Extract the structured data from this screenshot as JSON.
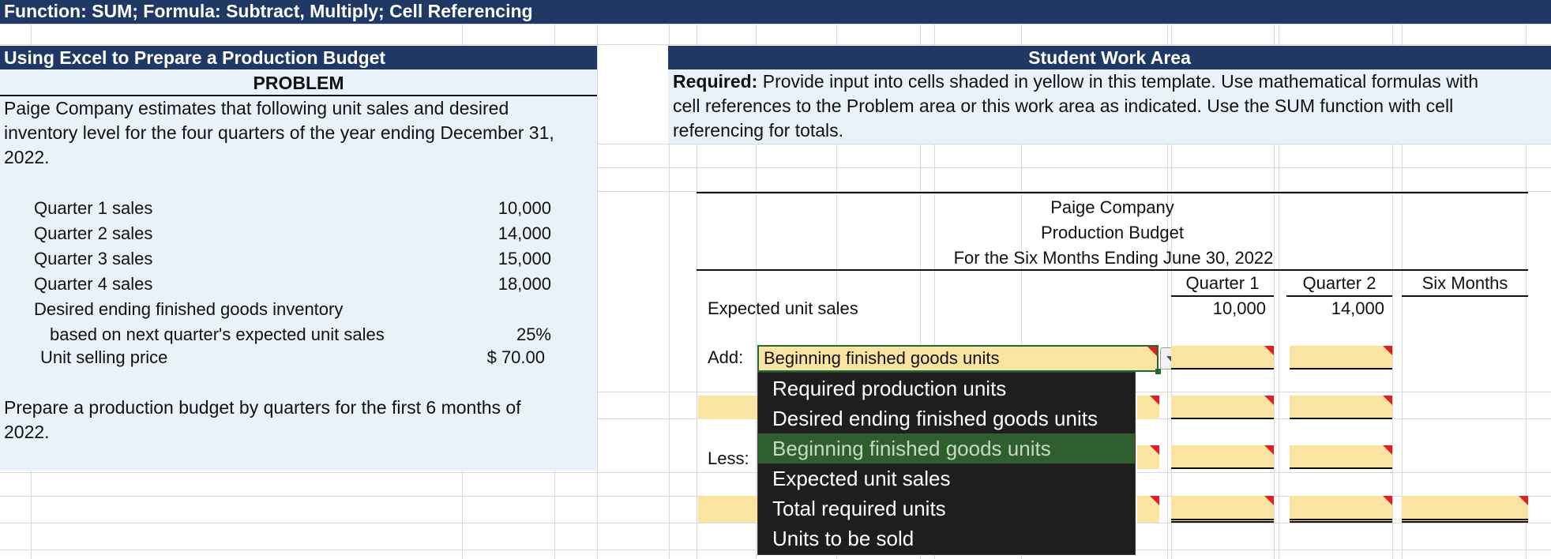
{
  "top_banner": "Function: SUM; Formula: Subtract, Multiply; Cell Referencing",
  "problem": {
    "header": "Using Excel to Prepare a Production Budget",
    "subheader": "PROBLEM",
    "desc_line1": "Paige Company estimates that following unit sales and desired",
    "desc_line2": "inventory level for the four quarters of the year ending December 31,",
    "desc_line3": "2022.",
    "rows": [
      {
        "label": "Quarter 1 sales",
        "value": "10,000"
      },
      {
        "label": "Quarter 2 sales",
        "value": "14,000"
      },
      {
        "label": "Quarter 3 sales",
        "value": "15,000"
      },
      {
        "label": "Quarter 4 sales",
        "value": "18,000"
      },
      {
        "label": "Desired ending finished goods inventory",
        "value": ""
      },
      {
        "label": "based on next quarter's expected unit sales",
        "value": "25%"
      },
      {
        "label": "Unit selling price",
        "value": "$  70.00"
      }
    ],
    "instr_line1": "Prepare a production budget by quarters for the first 6 months of",
    "instr_line2": "2022."
  },
  "work": {
    "header": "Student Work Area",
    "required_bold": "Required:",
    "required_l1": " Provide input into cells shaded in yellow in this template. Use mathematical formulas with",
    "required_l2": "cell references to the Problem area or this work area as indicated. Use the SUM function with cell",
    "required_l3": "referencing for totals.",
    "company": "Paige Company",
    "budget_title": "Production Budget",
    "period": "For the Six Months Ending June 30, 2022",
    "col_headers": [
      "Quarter 1",
      "Quarter 2",
      "Six Months"
    ],
    "expected_label": "Expected unit sales",
    "expected_values": [
      "10,000",
      "14,000",
      ""
    ],
    "add_label": "Add:",
    "add_selected": "Beginning finished goods units",
    "less_label": "Less:"
  },
  "dropdown": {
    "options": [
      "Required production units",
      "Desired ending finished goods units",
      "Beginning finished goods units",
      "Expected unit sales",
      "Total required units",
      "Units to be sold"
    ],
    "highlighted": "Beginning finished goods units"
  },
  "colors": {
    "header_navy": "#1f3864",
    "panel_blue": "#e9f1fa",
    "input_yellow": "#fbe3a1",
    "dropdown_bg": "#1e1e1e",
    "dropdown_highlight": "#2f5f2d",
    "comment_marker": "#e02020"
  },
  "icons": [
    "dropdown-arrow-icon",
    "comment-indicator-icon"
  ]
}
